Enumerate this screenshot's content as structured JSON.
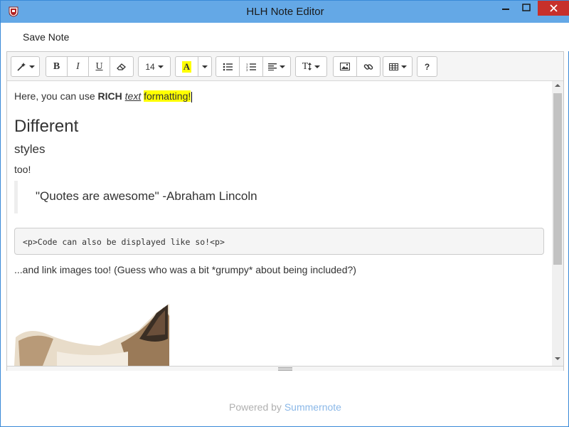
{
  "window": {
    "title": "HLH Note Editor",
    "minimize_glyph": "—",
    "maximize_glyph": "☐",
    "close_glyph": "✕"
  },
  "menu": {
    "save_label": "Save Note"
  },
  "toolbar": {
    "bold": "B",
    "italic": "I",
    "underline": "U",
    "font_size": "14",
    "color_letter": "A",
    "highlight_color": "#ffff00",
    "line_height_label": "T",
    "help": "?"
  },
  "content": {
    "intro_before": "Here, you can use ",
    "intro_bold": "RICH",
    "intro_italic": "text",
    "intro_highlight": "formatting!",
    "heading1": "Different",
    "heading2": "styles",
    "too": "too!",
    "quote": "\"Quotes are awesome\" -Abraham Lincoln",
    "code": "<p>Code can also be displayed like so!<p>",
    "images_text": "...and link images too! (Guess who was a bit *grumpy* about being included?)"
  },
  "footer": {
    "prefix": "Powered by ",
    "link": "Summernote"
  }
}
